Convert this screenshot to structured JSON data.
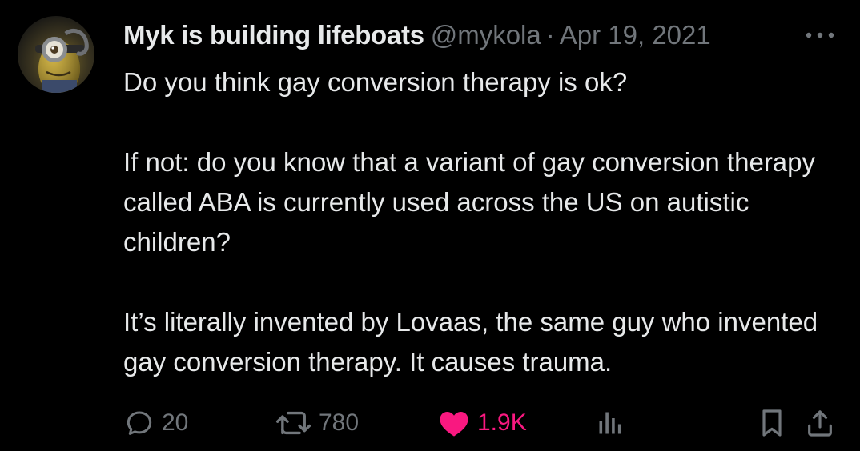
{
  "tweet": {
    "author_name": "Myk is building lifeboats",
    "handle": "@mykola",
    "separator": "·",
    "date": "Apr 19, 2021",
    "paragraphs": [
      "Do you think gay conversion therapy is ok?",
      "If not: do you know that a variant of gay conversion therapy called ABA is currently used across the US on autistic children?",
      "It’s literally invented by Lovaas, the same guy who invented gay conversion therapy. It causes trauma."
    ]
  },
  "actions": {
    "replies": "20",
    "retweets": "780",
    "likes": "1.9K",
    "liked": true
  },
  "icons": {
    "more": "more-horizontal-icon",
    "reply": "reply-icon",
    "retweet": "retweet-icon",
    "like": "heart-icon",
    "views": "analytics-icon",
    "bookmark": "bookmark-icon",
    "share": "share-icon"
  },
  "colors": {
    "background": "#000000",
    "text": "#e7e9ea",
    "secondary": "#71767b",
    "like": "#f91880"
  }
}
